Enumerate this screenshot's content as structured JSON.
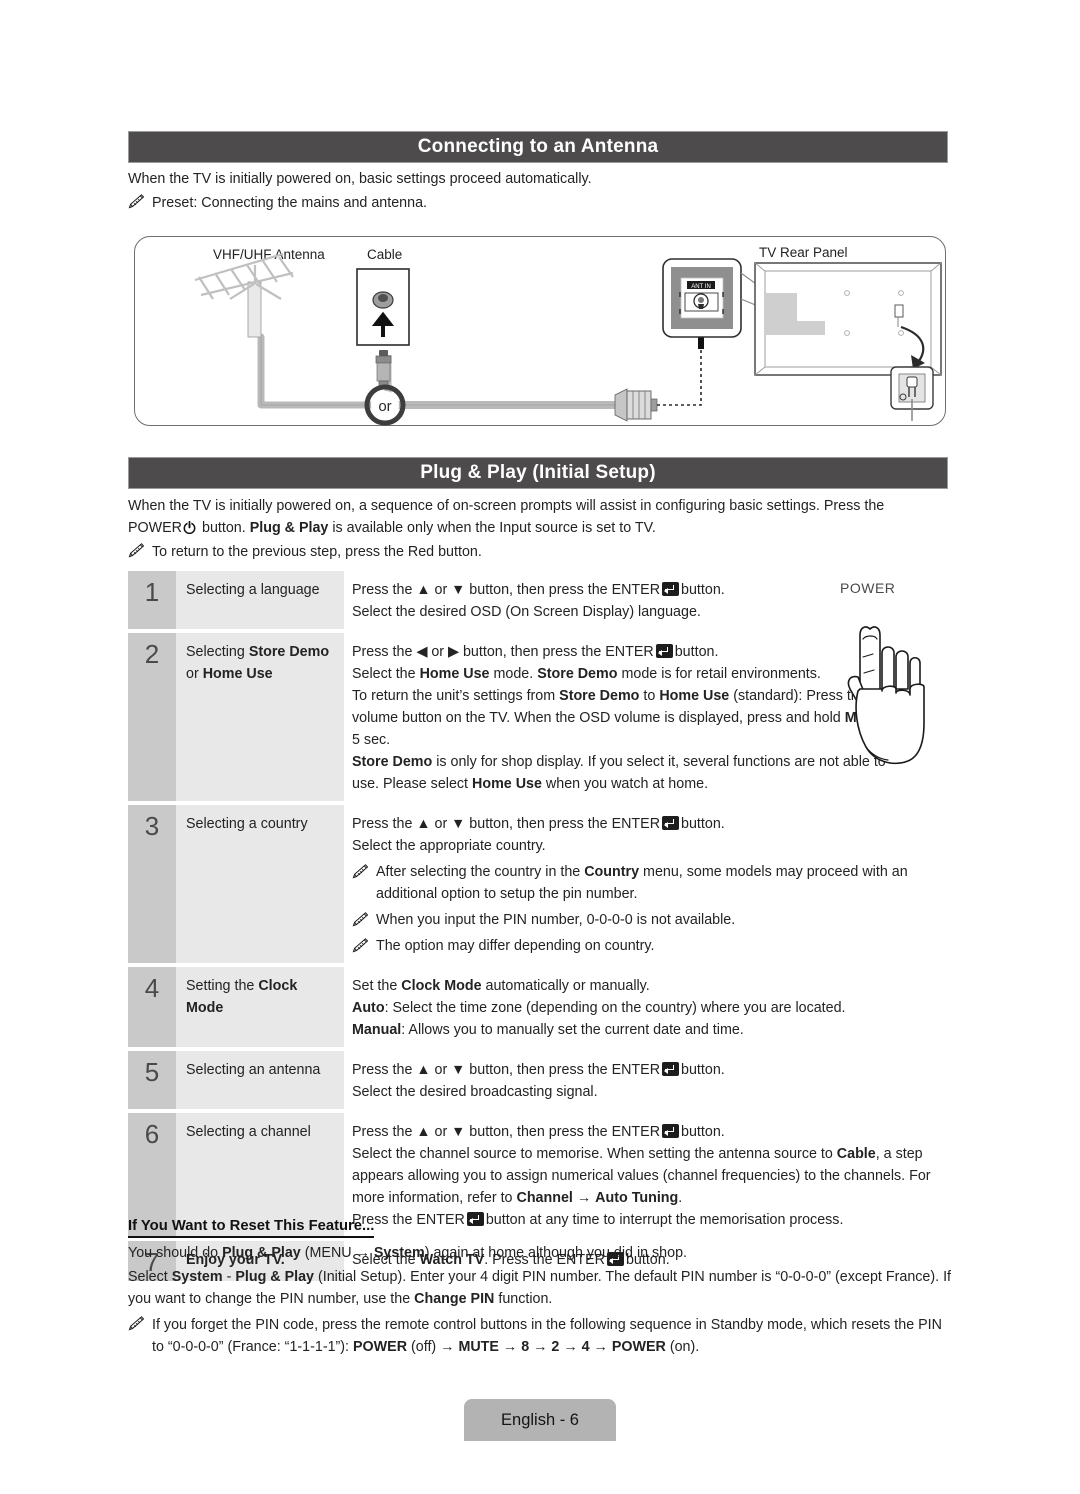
{
  "sections": {
    "antenna": {
      "heading": "Connecting to an Antenna",
      "intro": "When the TV is initially powered on, basic settings proceed automatically.",
      "note": "Preset: Connecting the mains and antenna.",
      "diagram": {
        "label_antenna": "VHF/UHF Antenna",
        "label_cable": "Cable",
        "label_tv": "TV Rear Panel",
        "label_or": "or",
        "label_ant_in": "ANT IN"
      }
    },
    "plugplay": {
      "heading": "Plug & Play (Initial Setup)",
      "intro_1": "When the TV is initially powered on, a sequence of on-screen prompts will assist in configuring basic settings. Press the",
      "intro_2a": "POWER",
      "intro_2b": "button.",
      "intro_2c": "Plug & Play",
      "intro_2d": "is available only when the Input source is set to TV.",
      "note": "To return to the previous step, press the Red button.",
      "power_label": "POWER"
    },
    "reset": {
      "heading": "If You Want to Reset This Feature...",
      "line1_a": "You should do",
      "line1_b": "Plug & Play",
      "line1_c": "(MENU",
      "line1_d": "System",
      "line1_e": ") again at home although you did in shop.",
      "line2_a": "Select",
      "line2_b": "System",
      "line2_c": "-",
      "line2_d": "Plug & Play",
      "line2_e": "(Initial Setup). Enter your 4 digit PIN number. The default PIN number is “0-0-0-0” (except France). If you want to change the PIN number, use the",
      "line2_f": "Change PIN",
      "line2_g": "function.",
      "note_a": "If you forget the PIN code, press the remote control buttons in the following sequence in Standby mode, which resets the PIN to “0-0-0-0” (France: “1-1-1-1”):",
      "note_b": "POWER",
      "note_c": "(off)",
      "note_d": "MUTE",
      "note_e": "8",
      "note_f": "2",
      "note_g": "4",
      "note_h": "POWER",
      "note_i": "(on)."
    }
  },
  "steps": [
    {
      "num": "1",
      "title_plain": "Selecting a language",
      "lines": [
        {
          "type": "text",
          "parts": [
            {
              "t": "Press the ▲ or ▼ button, then press the ENTER "
            },
            {
              "t": "ENTER_KEY",
              "icon": true
            },
            {
              "t": " button."
            }
          ]
        },
        {
          "type": "text",
          "parts": [
            {
              "t": "Select the desired OSD (On Screen Display) language."
            }
          ]
        }
      ]
    },
    {
      "num": "2",
      "title_parts": [
        "Selecting ",
        "Store Demo",
        " or ",
        "Home Use"
      ],
      "lines": []
    },
    {
      "num": "3",
      "title_plain": "Selecting a country",
      "lines": []
    },
    {
      "num": "4",
      "title_parts": [
        "Setting the ",
        "Clock Mode"
      ],
      "lines": []
    },
    {
      "num": "5",
      "title_plain": "Selecting an antenna",
      "lines": []
    },
    {
      "num": "6",
      "title_plain": "Selecting a channel",
      "lines": []
    },
    {
      "num": "7",
      "title_bold": "Enjoy your TV.",
      "lines": []
    }
  ],
  "step_text": {
    "s1_l1_a": "Press the ▲ or ▼ button, then press the ENTER",
    "s1_l1_b": "button.",
    "s1_l2": "Select the desired OSD (On Screen Display) language.",
    "s2_l1_a": "Press the ◀ or ▶ button, then press the ENTER",
    "s2_l1_b": "button.",
    "s2_l2_a": "Select the",
    "s2_l2_b": "Home Use",
    "s2_l2_c": "mode.",
    "s2_l2_d": "Store Demo",
    "s2_l2_e": "mode is for retail environments.",
    "s2_l3_a": "To return the unit’s settings from",
    "s2_l3_b": "Store Demo",
    "s2_l3_c": "to",
    "s2_l3_d": "Home Use",
    "s2_l3_e": "(standard): Press the volume button on the TV. When the OSD volume is displayed, press and hold",
    "s2_l3_f": "MENU",
    "s2_l3_g": "for 5 sec.",
    "s2_l4_a": "Store Demo",
    "s2_l4_b": "is only for shop display. If you select it, several functions are not able to use. Please select",
    "s2_l4_c": "Home Use",
    "s2_l4_d": "when you watch at home.",
    "s3_l1_a": "Press the ▲ or ▼ button, then press the ENTER",
    "s3_l1_b": "button.",
    "s3_l2": "Select the appropriate country.",
    "s3_n1_a": "After selecting the country in the",
    "s3_n1_b": "Country",
    "s3_n1_c": "menu, some models may proceed with an additional option to setup the pin number.",
    "s3_n2": "When you input the PIN number, 0-0-0-0 is not available.",
    "s3_n3": "The option may differ depending on country.",
    "s4_l1_a": "Set the",
    "s4_l1_b": "Clock Mode",
    "s4_l1_c": "automatically or manually.",
    "s4_l2_a": "Auto",
    "s4_l2_b": ": Select the time zone (depending on the country) where you are located.",
    "s4_l3_a": "Manual",
    "s4_l3_b": ": Allows you to manually set the current date and time.",
    "s5_l1_a": "Press the ▲ or ▼ button, then press the ENTER",
    "s5_l1_b": "button.",
    "s5_l2": "Select the desired broadcasting signal.",
    "s6_l1_a": "Press the ▲ or ▼ button, then press the ENTER",
    "s6_l1_b": "button.",
    "s6_l2_a": "Select the channel source to memorise. When setting the antenna source to",
    "s6_l2_b": "Cable",
    "s6_l2_c": ", a step appears allowing you to assign numerical values (channel frequencies) to the channels. For more information, refer to",
    "s6_l2_d": "Channel",
    "s6_l2_e": "→",
    "s6_l2_f": "Auto Tuning",
    "s6_l2_g": ".",
    "s6_l3_a": "Press the ENTER",
    "s6_l3_b": "button at any time to interrupt the memorisation process.",
    "s7_l1_a": "Select the",
    "s7_l1_b": "Watch TV",
    "s7_l1_c": ". Press the ENTER",
    "s7_l1_d": "button."
  },
  "step_titles": {
    "t1": "Selecting a language",
    "t2_a": "Selecting",
    "t2_b": "Store Demo",
    "t2_c": "or",
    "t2_d": "Home Use",
    "t3": "Selecting a country",
    "t4_a": "Setting the",
    "t4_b": "Clock",
    "t4_c": "Mode",
    "t5": "Selecting an antenna",
    "t6": "Selecting a channel",
    "t7": "Enjoy your TV."
  },
  "step_numbers": {
    "n1": "1",
    "n2": "2",
    "n3": "3",
    "n4": "4",
    "n5": "5",
    "n6": "6",
    "n7": "7"
  },
  "footer": {
    "label": "English - 6"
  },
  "colors": {
    "header_bar": "#4d4b4c",
    "step_num_bg": "#c9c9c9",
    "step_title_bg": "#e8e8e8",
    "footer_bg": "#b3b3b3",
    "text": "#232323"
  }
}
